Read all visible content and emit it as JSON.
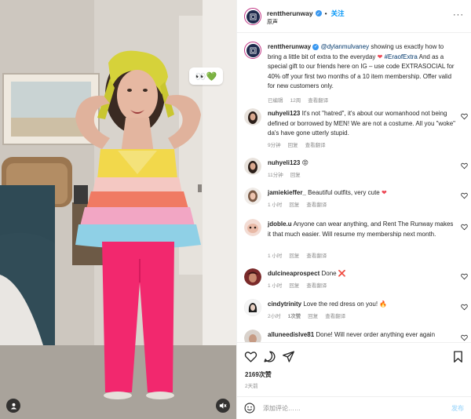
{
  "header": {
    "username": "renttherunway",
    "separator": "•",
    "follow_label": "关注",
    "audio_label": "原声",
    "more_label": "···"
  },
  "media": {
    "sticker_text": "👀💚"
  },
  "caption": {
    "username": "renttherunway",
    "mention": "@dylanmulvaney",
    "text_1": "showing us exactly how to bring a little bit of extra to the everyday",
    "heart": "❤",
    "hashtag": "#EraofExtra",
    "text_2": "And as a special gift to our friends here on IG – use code EXTRASOCIAL for 40% off your first two months of a 10 item membership. Offer valid for new customers only.",
    "edited": "已编辑",
    "time": "12周",
    "translate": "查看翻译"
  },
  "comments": [
    {
      "username": "nuhyeli123",
      "text": "It's not \"hatred\", it's about our womanhood not being defined or borrowed by MEN! We are not a costume. All you \"woke\" da's have gone utterly stupid.",
      "time": "9分钟",
      "reply": "回复",
      "translate": "查看翻译",
      "emoji": ""
    },
    {
      "username": "nuhyeli123",
      "text": "",
      "time": "11分钟",
      "reply": "回复",
      "translate": "",
      "emoji": "😡"
    },
    {
      "username": "jamiekieffer_",
      "text": "Beautiful outfits, very cute",
      "time": "1 小时",
      "reply": "回复",
      "translate": "查看翻译",
      "emoji": "❤"
    },
    {
      "username": "jdoble.u",
      "text": "Anyone can wear anything, and Rent The Runway makes it that much easier. Will resume my membership next month.",
      "time": "1 小时",
      "reply": "回复",
      "translate": "查看翻译",
      "emoji": ""
    },
    {
      "username": "dulcineaprospect",
      "text": "Done",
      "time": "1 小时",
      "reply": "回复",
      "translate": "查看翻译",
      "emoji": "❌"
    },
    {
      "username": "cindytrinity",
      "text": "Love the red dress on you!",
      "time": "2小时",
      "likes": "1次赞",
      "reply": "回复",
      "translate": "查看翻译",
      "emoji": "🔥"
    },
    {
      "username": "alluneedislve81",
      "text": "Done! Will never order anything ever again",
      "time": "",
      "reply": "",
      "translate": "",
      "emoji": ""
    }
  ],
  "actions": {
    "likes": "2169次赞",
    "posted": "2天前"
  },
  "add_comment": {
    "placeholder": "添加评论……",
    "post_label": "发布"
  },
  "icons": {
    "verified": "verified-badge-icon",
    "like": "heart-outline-icon",
    "comment": "comment-bubble-icon",
    "share": "paper-plane-icon",
    "save": "bookmark-icon",
    "emoji": "smiley-icon",
    "more": "more-dots-icon",
    "mute": "speaker-mute-icon",
    "user": "user-tag-icon"
  },
  "colors": {
    "link": "#00376b",
    "verified": "#3897f0",
    "follow": "#0095f6",
    "muted": "#8e8e8e",
    "heart": "#ed4956"
  }
}
